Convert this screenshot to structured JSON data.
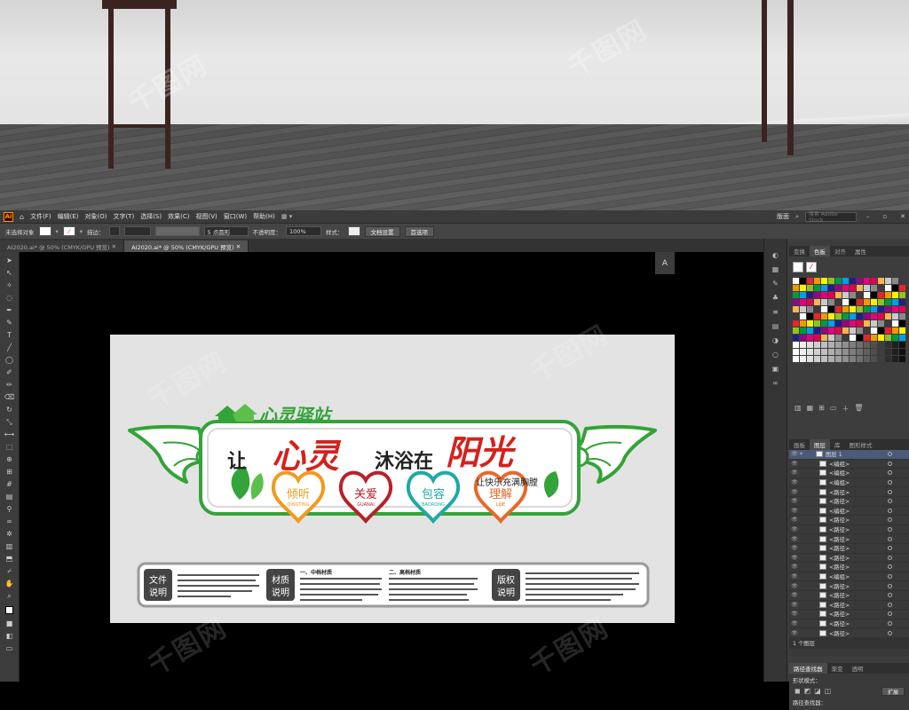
{
  "watermark": "千图网",
  "app": {
    "logo": "Ai",
    "menu": [
      "文件(F)",
      "编辑(E)",
      "对象(O)",
      "文字(T)",
      "选择(S)",
      "效果(C)",
      "视图(V)",
      "窗口(W)",
      "帮助(H)"
    ],
    "right_menu": "版面",
    "search_placeholder": "搜索 Adobe Stock"
  },
  "control": {
    "selection": "未选择对象",
    "stroke_label": "描边：",
    "brush": "5 点圆形",
    "opacity_label": "不透明度：",
    "opacity": "100%",
    "style_label": "样式：",
    "doc_setup": "文档设置",
    "prefs": "首选项"
  },
  "tabs": [
    {
      "label": "AI2020.ai* @ 50% (CMYK/GPU 预览)",
      "active": false
    },
    {
      "label": "AI2020.ai* @ 50% (CMYK/GPU 预览)",
      "active": true
    }
  ],
  "artwork": {
    "brand": "心灵驿站",
    "slogan_1": "让",
    "slogan_2": "心灵",
    "slogan_3": "沐浴在",
    "slogan_4": "阳光",
    "sub": "让快乐充满胸膛",
    "hearts": [
      {
        "cn": "倾听",
        "en": "QINGTING",
        "color": "#f19a1d"
      },
      {
        "cn": "关爱",
        "en": "GUANAI",
        "color": "#b52228"
      },
      {
        "cn": "包容",
        "en": "BAORONG",
        "color": "#1fa9a6"
      },
      {
        "cn": "理解",
        "en": "LIJIE",
        "color": "#e7692a"
      }
    ],
    "info_labels": [
      {
        "top": "文件",
        "bottom": "说明"
      },
      {
        "top": "材质",
        "bottom": "说明"
      },
      {
        "top": "版权",
        "bottom": "说明"
      }
    ],
    "mid_title": "一、中档材质",
    "high_title": "二、高档材质"
  },
  "swatch_panel": {
    "tabs": [
      "变换",
      "色板",
      "对齐",
      "属性"
    ],
    "active": "色板"
  },
  "layers_panel": {
    "tabs": [
      "画板",
      "图层",
      "库",
      "图形样式"
    ],
    "active": "图层",
    "layer_name": "图层 1",
    "rows": [
      "<编组>",
      "<编组>",
      "<编组>",
      "<路径>",
      "<路径>",
      "<编组>",
      "<路径>",
      "<路径>",
      "<路径>",
      "<路径>",
      "<路径>",
      "<路径>",
      "<编组>",
      "<路径>",
      "<路径>",
      "<路径>",
      "<路径>",
      "<路径>",
      "<路径>"
    ],
    "footer": "1 个图层"
  },
  "pathfinder": {
    "tabs": [
      "路径查找器",
      "渐变",
      "透明"
    ],
    "shape_mode": "形状模式：",
    "pathfinder_label": "路径查找器：",
    "expand": "扩展"
  },
  "colors": {
    "green": "#34a339",
    "red": "#d6201c",
    "ui_bg": "#454545"
  }
}
